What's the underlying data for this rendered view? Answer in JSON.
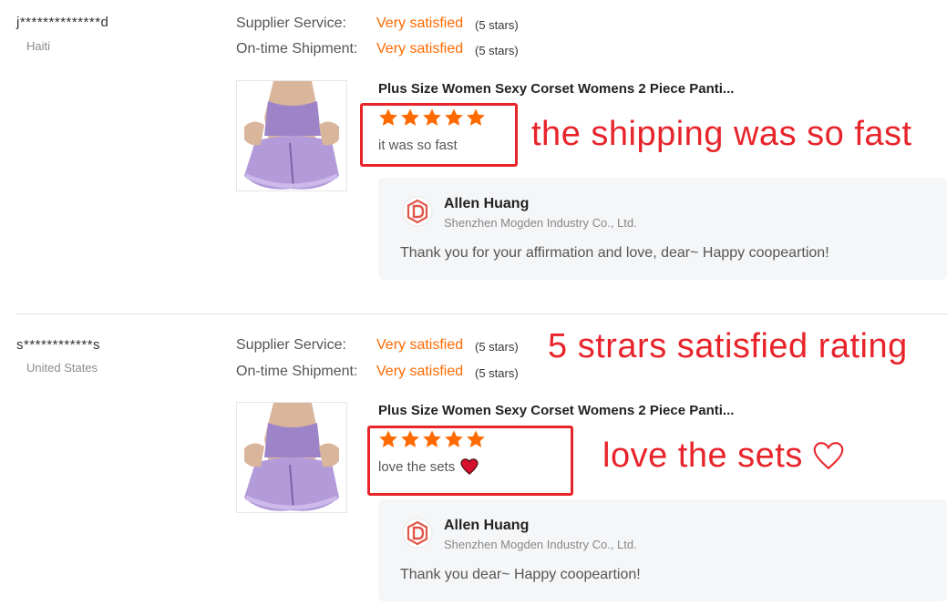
{
  "reviews": [
    {
      "buyer_name": "j**************d",
      "buyer_country": "Haiti",
      "ratings": [
        {
          "label": "Supplier Service:",
          "value": "Very satisfied",
          "stars_text": "(5 stars)"
        },
        {
          "label": "On-time Shipment:",
          "value": "Very satisfied",
          "stars_text": "(5 stars)"
        }
      ],
      "product_title": "Plus Size Women Sexy Corset Womens 2 Piece Panti...",
      "star_rating": 5,
      "comment": "it was so fast",
      "annotation": "the shipping was so fast",
      "reply": {
        "name": "Allen Huang",
        "company": "Shenzhen Mogden Industry Co., Ltd.",
        "text": "Thank you for your affirmation and love, dear~ Happy coopeartion!"
      }
    },
    {
      "buyer_name": "s************s",
      "buyer_country": "United States",
      "ratings": [
        {
          "label": "Supplier Service:",
          "value": "Very satisfied",
          "stars_text": "(5 stars)"
        },
        {
          "label": "On-time Shipment:",
          "value": "Very satisfied",
          "stars_text": "(5 stars)"
        }
      ],
      "rating_annotation": "5 strars satisfied rating",
      "product_title": "Plus Size Women Sexy Corset Womens 2 Piece Panti...",
      "star_rating": 5,
      "comment": "love the sets",
      "annotation": "love the sets",
      "reply": {
        "name": "Allen Huang",
        "company": "Shenzhen Mogden Industry Co., Ltd.",
        "text": "Thank you dear~ Happy coopeartion!"
      }
    }
  ],
  "colors": {
    "rating_orange": "#ff6a00",
    "annotation_red": "#e8242b",
    "reply_bg": "#f5f6f8",
    "product_lavender": "#b39bd9"
  },
  "icons": [
    "star-icon",
    "heart-emoji-icon",
    "outline-heart-icon",
    "company-logo-icon"
  ]
}
